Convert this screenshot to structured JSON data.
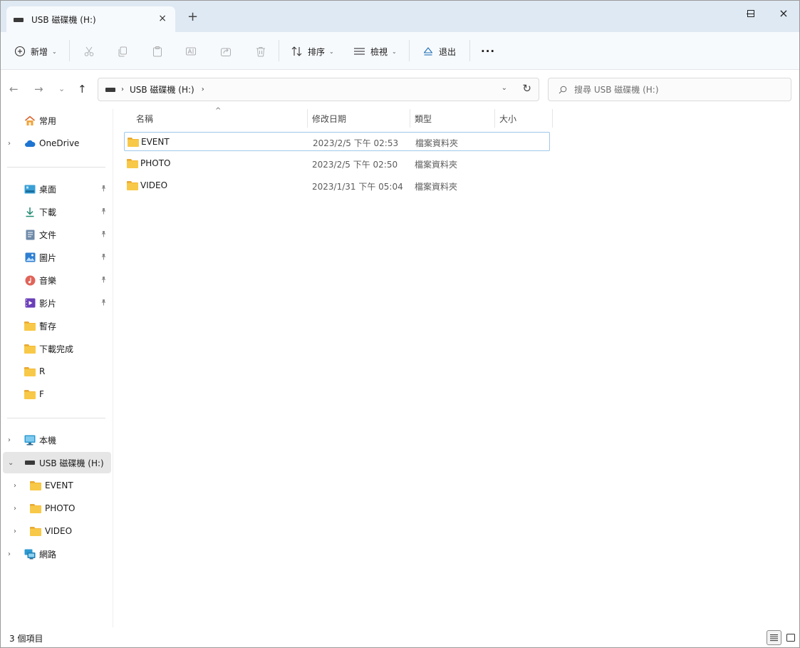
{
  "window": {
    "tab_title": "USB 磁碟機 (H:)",
    "tab_close_icon": "×",
    "new_tab_icon": "+",
    "minimize_icon": "minimize-icon",
    "maximize_icon": "maximize-icon",
    "close_icon": "×"
  },
  "toolbar": {
    "new_label": "新增",
    "sort_label": "排序",
    "view_label": "檢視",
    "eject_label": "退出",
    "more_label": "···",
    "dropdown_chevron": "⌄"
  },
  "nav": {
    "back": "←",
    "forward": "→",
    "recent": "⌄",
    "up": "↑",
    "crumb_sep": "›",
    "crumb": "USB 磁碟機 (H:)",
    "crumb_tail": "›",
    "address_dropdown": "⌄",
    "refresh": "↻",
    "search_placeholder": "搜尋 USB 磁碟機 (H:)",
    "search_icon": "⚲"
  },
  "sidebar": {
    "home": "常用",
    "onedrive": "OneDrive",
    "quick_access": [
      {
        "label": "桌面",
        "icon": "desktop-icon"
      },
      {
        "label": "下載",
        "icon": "download-icon"
      },
      {
        "label": "文件",
        "icon": "document-icon"
      },
      {
        "label": "圖片",
        "icon": "pictures-icon"
      },
      {
        "label": "音樂",
        "icon": "music-icon"
      },
      {
        "label": "影片",
        "icon": "videos-icon"
      }
    ],
    "folders": [
      "暫存",
      "下載完成",
      "R",
      "F"
    ],
    "this_pc": "本機",
    "usb_drive": "USB 磁碟機 (H:)",
    "usb_children": [
      "EVENT",
      "PHOTO",
      "VIDEO"
    ],
    "network": "網路",
    "pin_glyph": "✎",
    "expand_glyph": "›",
    "collapse_glyph": "⌄"
  },
  "columns": {
    "name": "名稱",
    "modified": "修改日期",
    "type": "類型",
    "size": "大小",
    "sort_indicator": "^"
  },
  "files": [
    {
      "name": "EVENT",
      "modified": "2023/2/5 下午 02:53",
      "type": "檔案資料夾",
      "size": ""
    },
    {
      "name": "PHOTO",
      "modified": "2023/2/5 下午 02:50",
      "type": "檔案資料夾",
      "size": ""
    },
    {
      "name": "VIDEO",
      "modified": "2023/1/31 下午 05:04",
      "type": "檔案資料夾",
      "size": ""
    }
  ],
  "status": {
    "item_count": "3 個項目"
  }
}
